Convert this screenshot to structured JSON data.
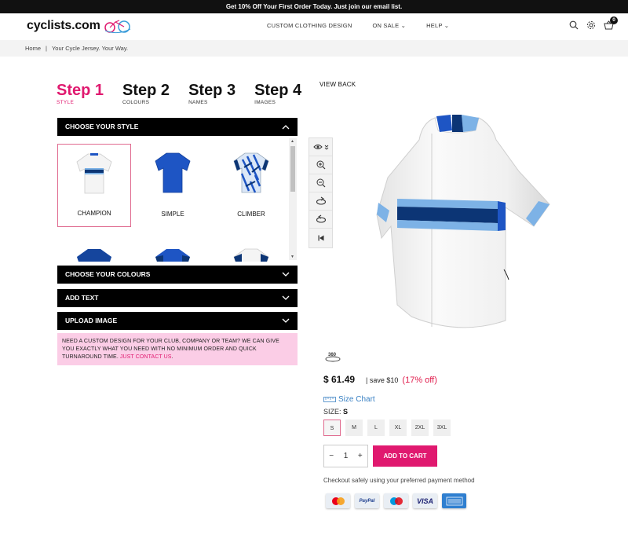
{
  "topbar": {
    "text": "Get 10% Off Your First Order Today. Just join our email list."
  },
  "header": {
    "logo": "cyclists.com",
    "nav": [
      "CUSTOM CLOTHING DESIGN",
      "ON SALE",
      "HELP"
    ],
    "cart_count": "0"
  },
  "breadcrumb": {
    "home": "Home",
    "sep": "|",
    "current": "Your Cycle Jersey. Your Way."
  },
  "steps": [
    {
      "title": "Step 1",
      "sub": "STYLE"
    },
    {
      "title": "Step 2",
      "sub": "COLOURS"
    },
    {
      "title": "Step 3",
      "sub": "NAMES"
    },
    {
      "title": "Step 4",
      "sub": "IMAGES"
    }
  ],
  "accordion": {
    "style": "CHOOSE YOUR STYLE",
    "colours": "CHOOSE YOUR COLOURS",
    "text": "ADD TEXT",
    "upload": "UPLOAD IMAGE"
  },
  "styles": [
    "CHAMPION",
    "SIMPLE",
    "CLIMBER"
  ],
  "promo": {
    "text": "NEED A CUSTOM DESIGN FOR YOUR CLUB, COMPANY OR TEAM? WE CAN GIVE YOU EXACTLY WHAT YOU NEED WITH NO MINIMUM ORDER AND QUICK TURNAROUND TIME. ",
    "link": "JUST CONTACT US",
    "end": "."
  },
  "viewer": {
    "view_back": "VIEW BACK",
    "rotate_label": "360"
  },
  "product": {
    "price": "$ 61.49",
    "save": "|  save $10",
    "off": "(17% off)",
    "size_chart": "Size Chart",
    "size_label": "SIZE:",
    "size_value": "S",
    "sizes": [
      "S",
      "M",
      "L",
      "XL",
      "2XL",
      "3XL"
    ],
    "quantity": "1",
    "add_to_cart": "ADD TO CART",
    "checkout_text": "Checkout safely using your preferred payment method",
    "payment_methods": [
      "MasterCard",
      "PayPal",
      "Maestro",
      "VISA",
      "American Express"
    ]
  },
  "colors": {
    "accent": "#e0196f",
    "promo_bg": "#fbcde6",
    "jersey_blue": "#1e55c4",
    "stripe_navy": "#0c3575",
    "stripe_light": "#7db2e6"
  }
}
